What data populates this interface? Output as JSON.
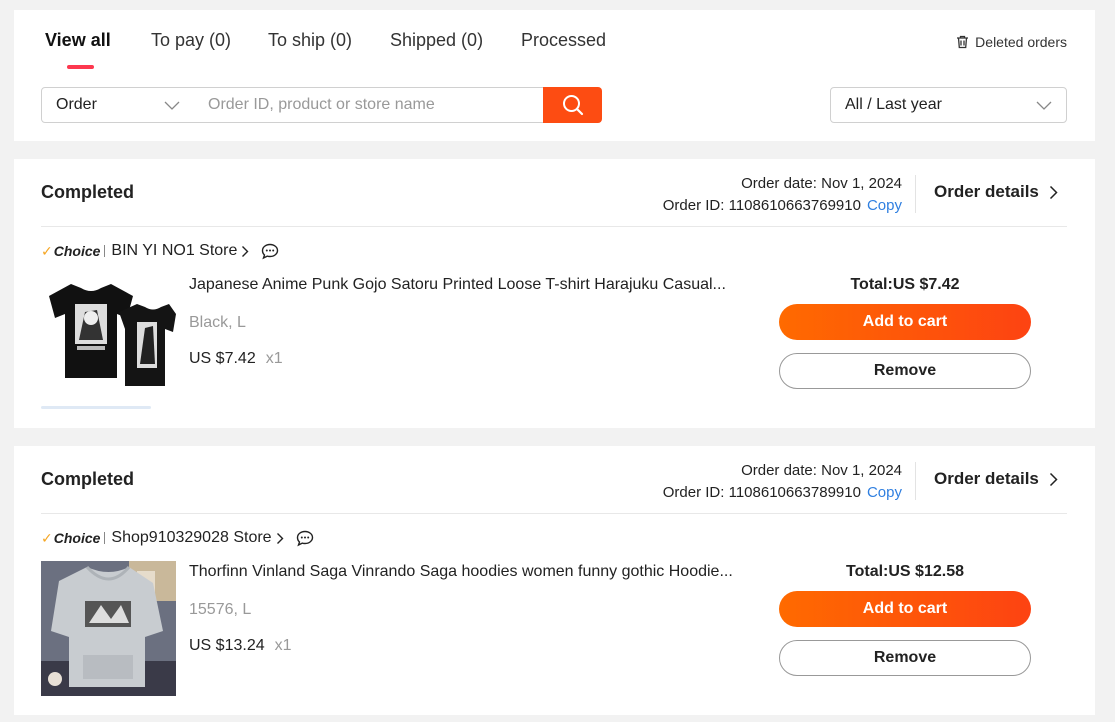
{
  "tabs": [
    {
      "label": "View all",
      "active": true
    },
    {
      "label": "To pay (0)",
      "active": false
    },
    {
      "label": "To ship (0)",
      "active": false
    },
    {
      "label": "Shipped (0)",
      "active": false
    },
    {
      "label": "Processed",
      "active": false
    }
  ],
  "deleted_orders": {
    "label": "Deleted orders",
    "icon": "trash-icon"
  },
  "search": {
    "type_select": "Order",
    "placeholder": "Order ID, product or store name",
    "button_icon": "search-icon"
  },
  "time_filter": {
    "selected": "All / Last year"
  },
  "labels": {
    "order_details": "Order details",
    "copy": "Copy",
    "order_date_prefix": "Order date: ",
    "order_id_prefix": "Order ID: ",
    "add_to_cart": "Add to cart",
    "remove": "Remove",
    "choice_badge": "Choice"
  },
  "orders": [
    {
      "status": "Completed",
      "order_date": "Nov 1, 2024",
      "order_id": "1108610663769910",
      "store": "BIN YI NO1 Store",
      "product_title": "Japanese Anime Punk Gojo Satoru Printed Loose T-shirt Harajuku Casual...",
      "sku": "Black, L",
      "price": "US $7.42",
      "qty": "x1",
      "total": "Total:US $7.42"
    },
    {
      "status": "Completed",
      "order_date": "Nov 1, 2024",
      "order_id": "1108610663789910",
      "store": "Shop910329028 Store",
      "product_title": "Thorfinn Vinland Saga Vinrando Saga hoodies women funny gothic Hoodie...",
      "sku": "15576, L",
      "price": "US $13.24",
      "qty": "x1",
      "total": "Total:US $12.58"
    }
  ],
  "colors": {
    "accent": "#fd4c12",
    "tab_underline": "#fd384f",
    "link": "#2f7fe0",
    "choice_check": "#f5a623"
  }
}
